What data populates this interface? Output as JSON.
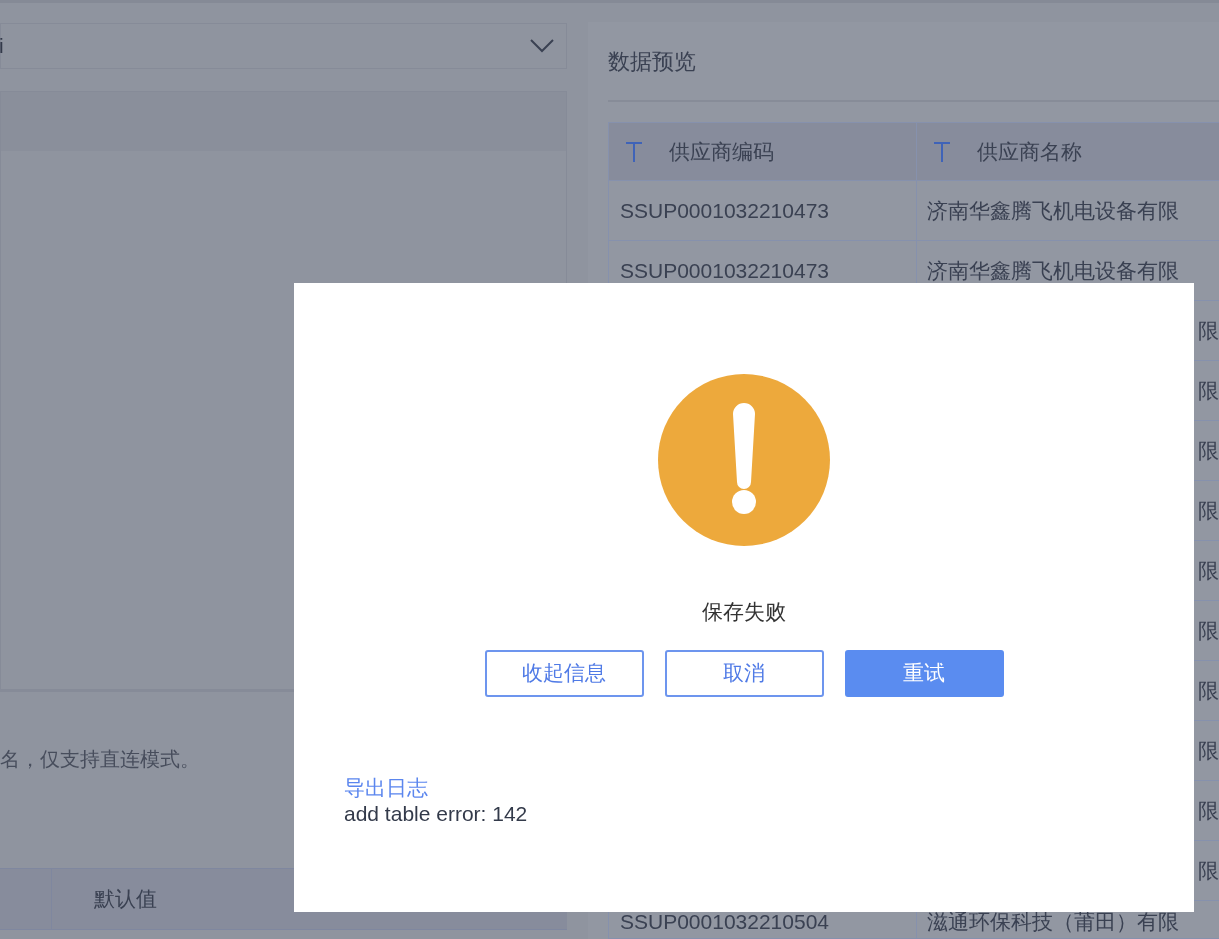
{
  "left_panel": {
    "dropdown": {
      "value": "i"
    },
    "hint": "名，仅支持直连模式。",
    "table": {
      "columns": [
        {
          "label": "默认值"
        }
      ]
    }
  },
  "preview": {
    "title": "数据预览",
    "table": {
      "columns": [
        {
          "label": "供应商编码"
        },
        {
          "label": "供应商名称"
        }
      ],
      "rows": [
        {
          "code": "SSUP0001032210473",
          "name": "济南华鑫腾飞机电设备有限"
        },
        {
          "code": "SSUP0001032210473",
          "name": "济南华鑫腾飞机电设备有限"
        },
        {
          "name": "限"
        },
        {
          "name": "限"
        },
        {
          "name": "限"
        },
        {
          "name": "限"
        },
        {
          "name": "限"
        },
        {
          "name": "限"
        },
        {
          "name": "限"
        },
        {
          "name": "限"
        },
        {
          "name": "限"
        },
        {
          "name": "限"
        },
        {
          "code": "SSUP0001032210504",
          "name": "滋通环保科技（莆田）有限"
        }
      ]
    }
  },
  "dialog": {
    "message": "保存失败",
    "buttons": [
      {
        "label": "收起信息",
        "kind": "outline"
      },
      {
        "label": "取消",
        "kind": "outline"
      },
      {
        "label": "重试",
        "kind": "primary"
      }
    ],
    "link": "导出日志",
    "log": "add table error: 142"
  }
}
